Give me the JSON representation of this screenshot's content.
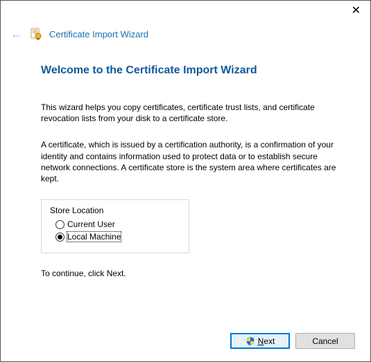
{
  "header": {
    "title": "Certificate Import Wizard"
  },
  "main": {
    "heading": "Welcome to the Certificate Import Wizard",
    "intro": "This wizard helps you copy certificates, certificate trust lists, and certificate revocation lists from your disk to a certificate store.",
    "description": "A certificate, which is issued by a certification authority, is a confirmation of your identity and contains information used to protect data or to establish secure network connections. A certificate store is the system area where certificates are kept.",
    "continue_hint": "To continue, click Next."
  },
  "store_location": {
    "legend": "Store Location",
    "options": [
      {
        "label": "Current User",
        "selected": false
      },
      {
        "label": "Local Machine",
        "selected": true
      }
    ]
  },
  "footer": {
    "next_label": "Next",
    "cancel_label": "Cancel"
  }
}
